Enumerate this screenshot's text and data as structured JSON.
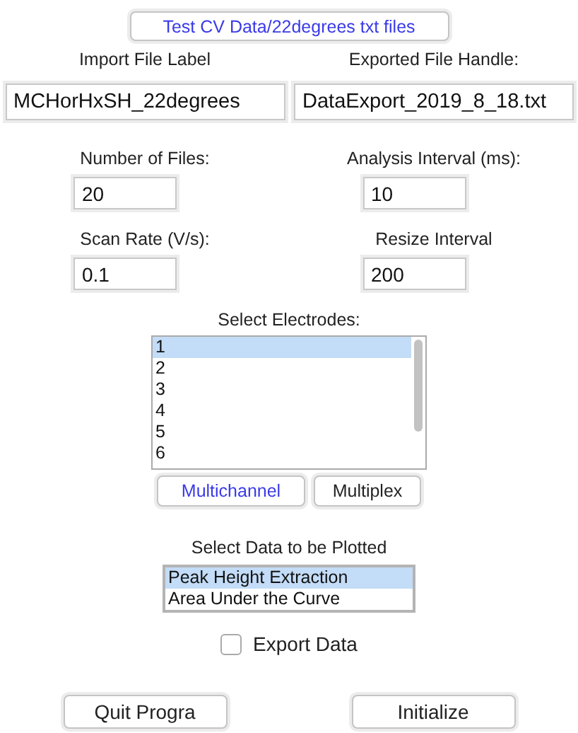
{
  "top_button": {
    "label": "Test CV Data/22degrees txt files",
    "default": true
  },
  "fields": [
    {
      "label": "Import File Label",
      "value": "MCHorHxSH_22degrees",
      "wide": true
    },
    {
      "label": "Exported File Handle:",
      "value": "DataExport_2019_8_18.txt",
      "wide": true
    },
    {
      "label": "Number of Files:",
      "value": "20",
      "wide": false
    },
    {
      "label": "Analysis Interval (ms):",
      "value": "10",
      "wide": false
    },
    {
      "label": "Scan Rate (V/s):",
      "value": "0.1",
      "wide": false
    },
    {
      "label": "Resize Interval",
      "value": "200",
      "wide": false
    }
  ],
  "electrodes": {
    "label": "Select Electrodes:",
    "items": [
      {
        "label": "1",
        "selected": true
      },
      {
        "label": "2",
        "selected": false
      },
      {
        "label": "3",
        "selected": false
      },
      {
        "label": "4",
        "selected": false
      },
      {
        "label": "5",
        "selected": false
      },
      {
        "label": "6",
        "selected": false
      }
    ],
    "buttons": [
      {
        "label": "Multichannel",
        "default": true
      },
      {
        "label": "Multiplex",
        "default": false
      }
    ]
  },
  "plot_data": {
    "label": "Select Data to be Plotted",
    "items": [
      {
        "label": "Peak Height Extraction",
        "selected": true
      },
      {
        "label": "Area Under the Curve",
        "selected": false
      }
    ]
  },
  "export_data": {
    "label": "Export Data",
    "checked": false
  },
  "bottom_buttons": [
    {
      "label": "Quit Progra"
    },
    {
      "label": "Initialize"
    }
  ]
}
